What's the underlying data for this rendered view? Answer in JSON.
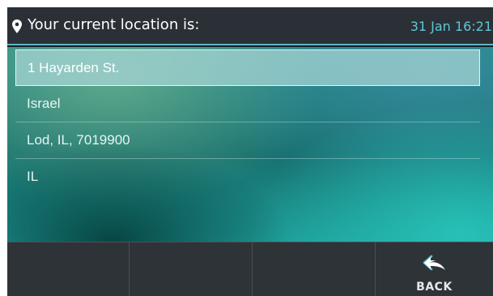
{
  "header": {
    "icon": "location-pin-icon",
    "title": "Your current location is:",
    "datetime": "31 Jan 16:21"
  },
  "location": {
    "items": [
      {
        "label": "1 Hayarden St.",
        "selected": true
      },
      {
        "label": "Israel",
        "selected": false
      },
      {
        "label": "Lod, IL, 7019900",
        "selected": false
      },
      {
        "label": "IL",
        "selected": false
      }
    ]
  },
  "softkeys": {
    "back": {
      "label": "BACK",
      "icon": "back-arrow-icon"
    }
  },
  "colors": {
    "accent": "#5fc7d4",
    "header_bg": "#2b3036",
    "softkey_bg": "#2e3338"
  }
}
